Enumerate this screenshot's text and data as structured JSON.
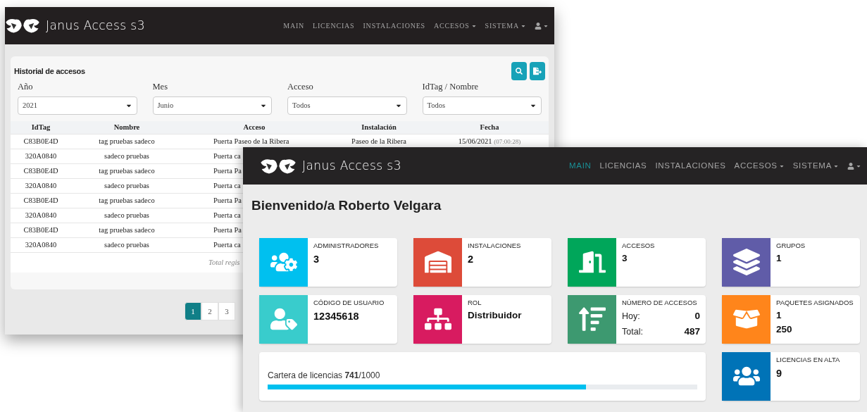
{
  "historial_window": {
    "brand": "Janus Access s3",
    "nav": [
      {
        "label": "MAIN",
        "dropdown": false,
        "selected": false
      },
      {
        "label": "LICENCIAS",
        "dropdown": false,
        "selected": false
      },
      {
        "label": "INSTALACIONES",
        "dropdown": false,
        "selected": false
      },
      {
        "label": "ACCESOS",
        "dropdown": true,
        "selected": false
      },
      {
        "label": "SISTEMA",
        "dropdown": true,
        "selected": false
      }
    ],
    "title": "Historial de accesos",
    "filters": [
      {
        "label": "Año",
        "value": "2021"
      },
      {
        "label": "Mes",
        "value": "Junio"
      },
      {
        "label": "Acceso",
        "value": "Todos"
      },
      {
        "label": "IdTag / Nombre",
        "value": "Todos"
      }
    ],
    "columns": [
      "IdTag",
      "Nombre",
      "Acceso",
      "Instalación",
      "Fecha"
    ],
    "rows": [
      {
        "idtag": "C83B0E4D",
        "nombre": "tag pruebas sadeco",
        "acceso": "Puerta Paseo de la Ribera",
        "instalacion": "Paseo de la Ribera",
        "fecha": "15/06/2021",
        "hora": "(07:00:28)"
      },
      {
        "idtag": "320A0840",
        "nombre": "sadeco pruebas",
        "acceso": "Puerta ca"
      },
      {
        "idtag": "C83B0E4D",
        "nombre": "tag pruebas sadeco",
        "acceso": "Puerta Pa"
      },
      {
        "idtag": "320A0840",
        "nombre": "sadeco pruebas",
        "acceso": "Puerta ca"
      },
      {
        "idtag": "C83B0E4D",
        "nombre": "tag pruebas sadeco",
        "acceso": "Puerta Pa"
      },
      {
        "idtag": "320A0840",
        "nombre": "sadeco pruebas",
        "acceso": "Puerta ca"
      },
      {
        "idtag": "C83B0E4D",
        "nombre": "tag pruebas sadeco",
        "acceso": "Puerta Pa"
      },
      {
        "idtag": "320A0840",
        "nombre": "sadeco pruebas",
        "acceso": "Puerta ca"
      }
    ],
    "total": "Total regis",
    "pages": [
      {
        "label": "1",
        "selected": true
      },
      {
        "label": "2",
        "selected": false
      },
      {
        "label": "3",
        "selected": false
      }
    ]
  },
  "dashboard_window": {
    "brand": "Janus Access s3",
    "nav": [
      {
        "label": "MAIN",
        "dropdown": false,
        "selected": true
      },
      {
        "label": "LICENCIAS",
        "dropdown": false,
        "selected": false
      },
      {
        "label": "INSTALACIONES",
        "dropdown": false,
        "selected": false
      },
      {
        "label": "ACCESOS",
        "dropdown": true,
        "selected": false
      },
      {
        "label": "SISTEMA",
        "dropdown": true,
        "selected": false
      }
    ],
    "title": "Bienvenido/a Roberto Velgara",
    "cards": [
      {
        "kind": "stat",
        "label": "ADMINISTRADORES",
        "values": [
          "3"
        ],
        "color": "#00c0ef"
      },
      {
        "kind": "stat",
        "label": "INSTALACIONES",
        "values": [
          "2"
        ],
        "color": "#dd4b39"
      },
      {
        "kind": "stat",
        "label": "ACCESOS",
        "values": [
          "3"
        ],
        "color": "#00a65a"
      },
      {
        "kind": "stat",
        "label": "GRUPOS",
        "values": [
          "1"
        ],
        "color": "#605ca8"
      },
      {
        "kind": "stat",
        "label": "CÓDIGO DE USUARIO",
        "values": [
          "12345618"
        ],
        "color": "#39cccc"
      },
      {
        "kind": "stat",
        "label": "ROL",
        "values": [
          "Distribuidor"
        ],
        "color": "#d81b60"
      },
      {
        "kind": "split",
        "label": "NÚMERO DE ACCESOS",
        "rows": [
          {
            "label": "Hoy:",
            "value": "0"
          },
          {
            "label": "Total:",
            "value": "487"
          }
        ],
        "color": "#3d9970"
      },
      {
        "kind": "stat",
        "label": "PAQUETES ASIGNADOS",
        "values": [
          "1",
          "250"
        ],
        "color": "#ff851b"
      },
      {
        "kind": "progress",
        "text": "Cartera de licencias **741**/1000",
        "level": 0.741
      },
      {
        "kind": "stat",
        "label": "LICENCIAS EN ALTA",
        "values": [
          "9"
        ],
        "color": "#0073b7"
      }
    ]
  }
}
